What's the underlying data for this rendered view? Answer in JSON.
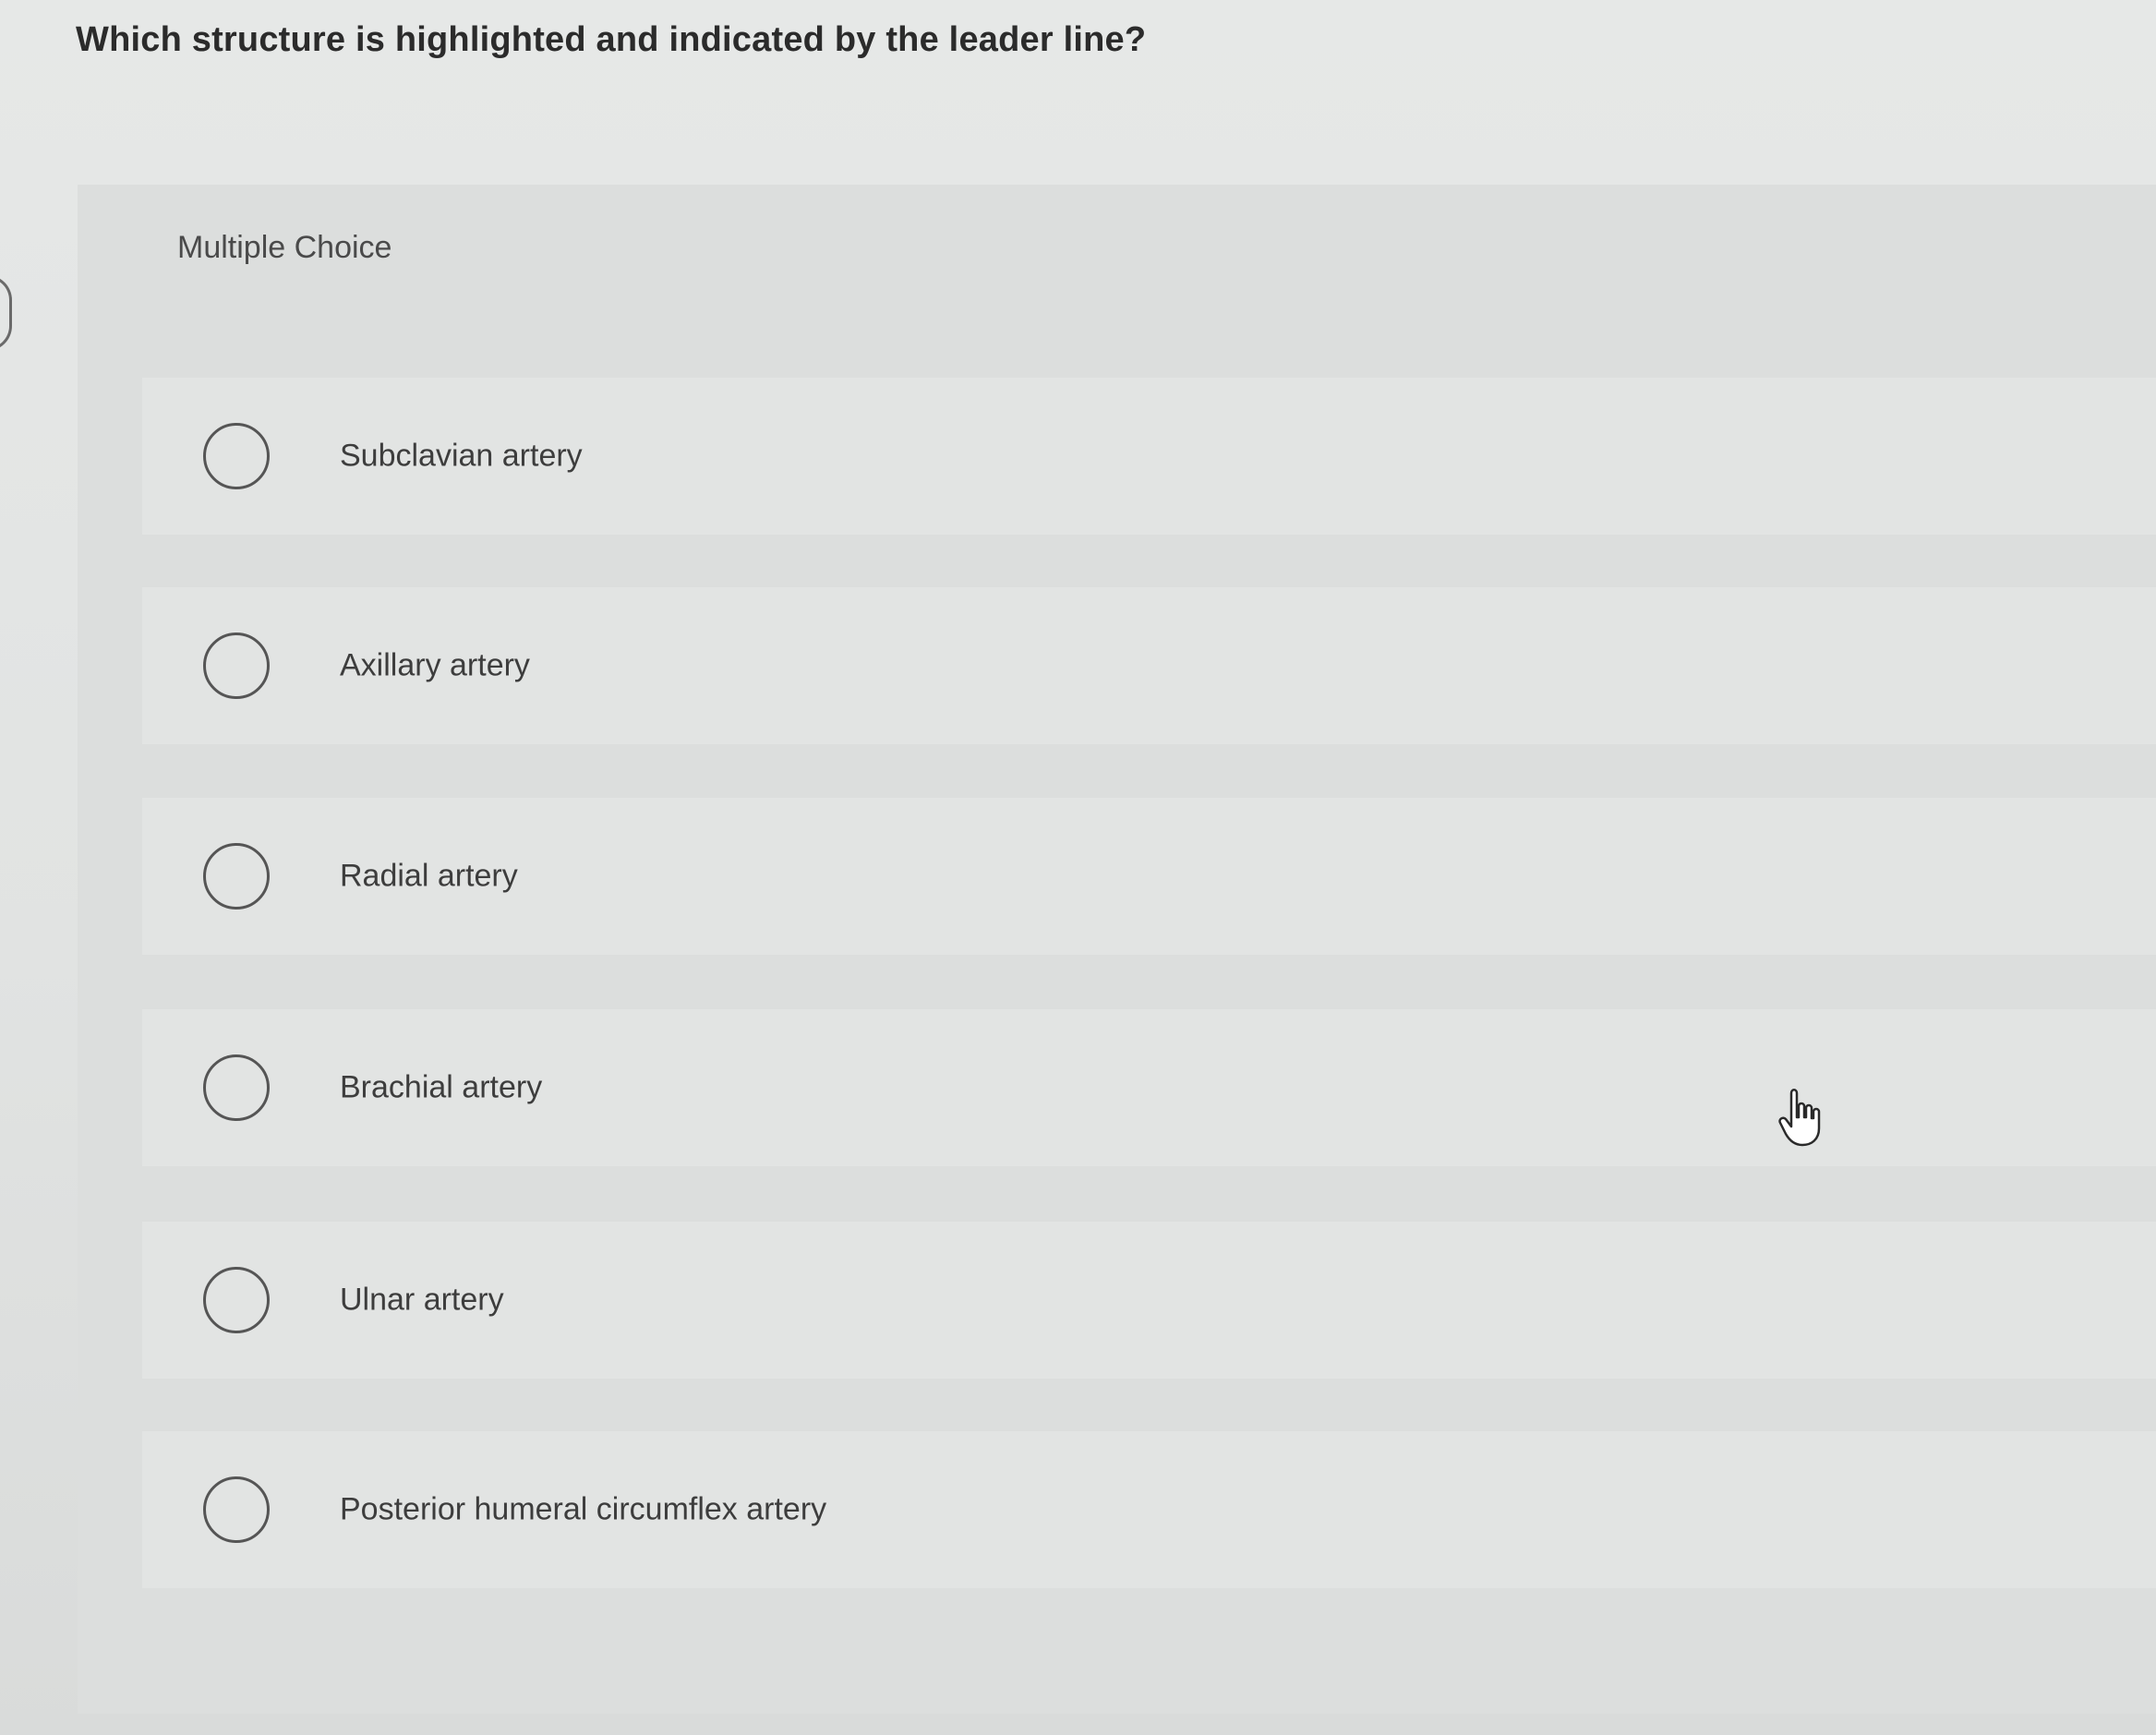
{
  "question": "Which structure is highlighted and indicated by the leader line?",
  "section_label": "Multiple Choice",
  "options": [
    {
      "label": "Subclavian artery"
    },
    {
      "label": "Axillary artery"
    },
    {
      "label": "Radial artery"
    },
    {
      "label": "Brachial artery"
    },
    {
      "label": "Ulnar artery"
    },
    {
      "label": "Posterior humeral circumflex artery"
    }
  ],
  "cursor": {
    "icon": "hand-pointer-icon"
  },
  "colors": {
    "background": "#e3e5e4",
    "panel": "#dcdedd",
    "option_row": "#e2e4e3",
    "text": "#333333"
  }
}
